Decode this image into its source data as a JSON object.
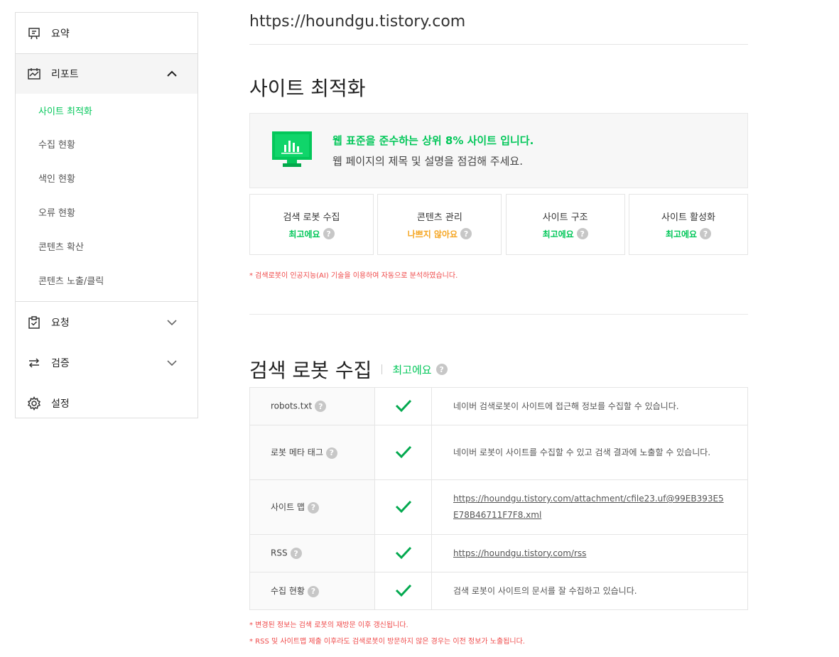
{
  "sidebar": {
    "summary": "요약",
    "report": "리포트",
    "report_items": [
      "사이트 최적화",
      "수집 현황",
      "색인 현황",
      "오류 현황",
      "콘텐츠 확산",
      "콘텐츠 노출/클릭"
    ],
    "request": "요청",
    "verify": "검증",
    "settings": "설정"
  },
  "main": {
    "url": "https://houndgu.tistory.com",
    "opt_title": "사이트 최적화",
    "banner_line1": "웹 표준을 준수하는 상위 8% 사이트 입니다.",
    "banner_line2": "웹 페이지의 제목 및 설명을 점검해 주세요.",
    "cards": [
      {
        "title": "검색 로봇 수집",
        "status": "최고에요"
      },
      {
        "title": "콘텐츠 관리",
        "status": "나쁘지 않아요"
      },
      {
        "title": "사이트 구조",
        "status": "최고에요"
      },
      {
        "title": "사이트 활성화",
        "status": "최고에요"
      }
    ],
    "note_ai": "* 검색로봇이 인공지능(AI) 기술을 이용하여 자동으로 분석하였습니다.",
    "crawl_title": "검색 로봇 수집",
    "crawl_status": "최고에요",
    "rows": [
      {
        "key": "robots.txt",
        "value": "네이버 검색로봇이 사이트에 접근해 정보를 수집할 수 있습니다."
      },
      {
        "key": "로봇 메타 태그",
        "value": "네이버 로봇이 사이트를 수집할 수 있고 검색 결과에 노출할 수 있습니다."
      },
      {
        "key": "사이트 맵",
        "value": "https://houndgu.tistory.com/attachment/cfile23.uf@99EB393E5E78B46711F7F8.xml"
      },
      {
        "key": "RSS",
        "value": "https://houndgu.tistory.com/rss"
      },
      {
        "key": "수집 현황",
        "value": "검색 로봇이 사이트의 문서를 잘 수집하고 있습니다."
      }
    ],
    "note_update": "* 변경된 정보는 검색 로봇의 재방문 이후 갱신됩니다.",
    "note_rss": "* RSS 및 사이트맵 제출 이후라도 검색로봇이 방문하지 않은 경우는 이전 정보가 노출됩니다."
  },
  "colors": {
    "accent": "#03c75a",
    "warn": "#f5a623",
    "note": "#ef4a4a"
  },
  "icons": [
    "summary-icon",
    "report-icon",
    "request-icon",
    "verify-icon",
    "settings-icon",
    "chevron-up-icon",
    "chevron-down-icon",
    "monitor-chart-icon",
    "check-icon",
    "help-icon"
  ]
}
